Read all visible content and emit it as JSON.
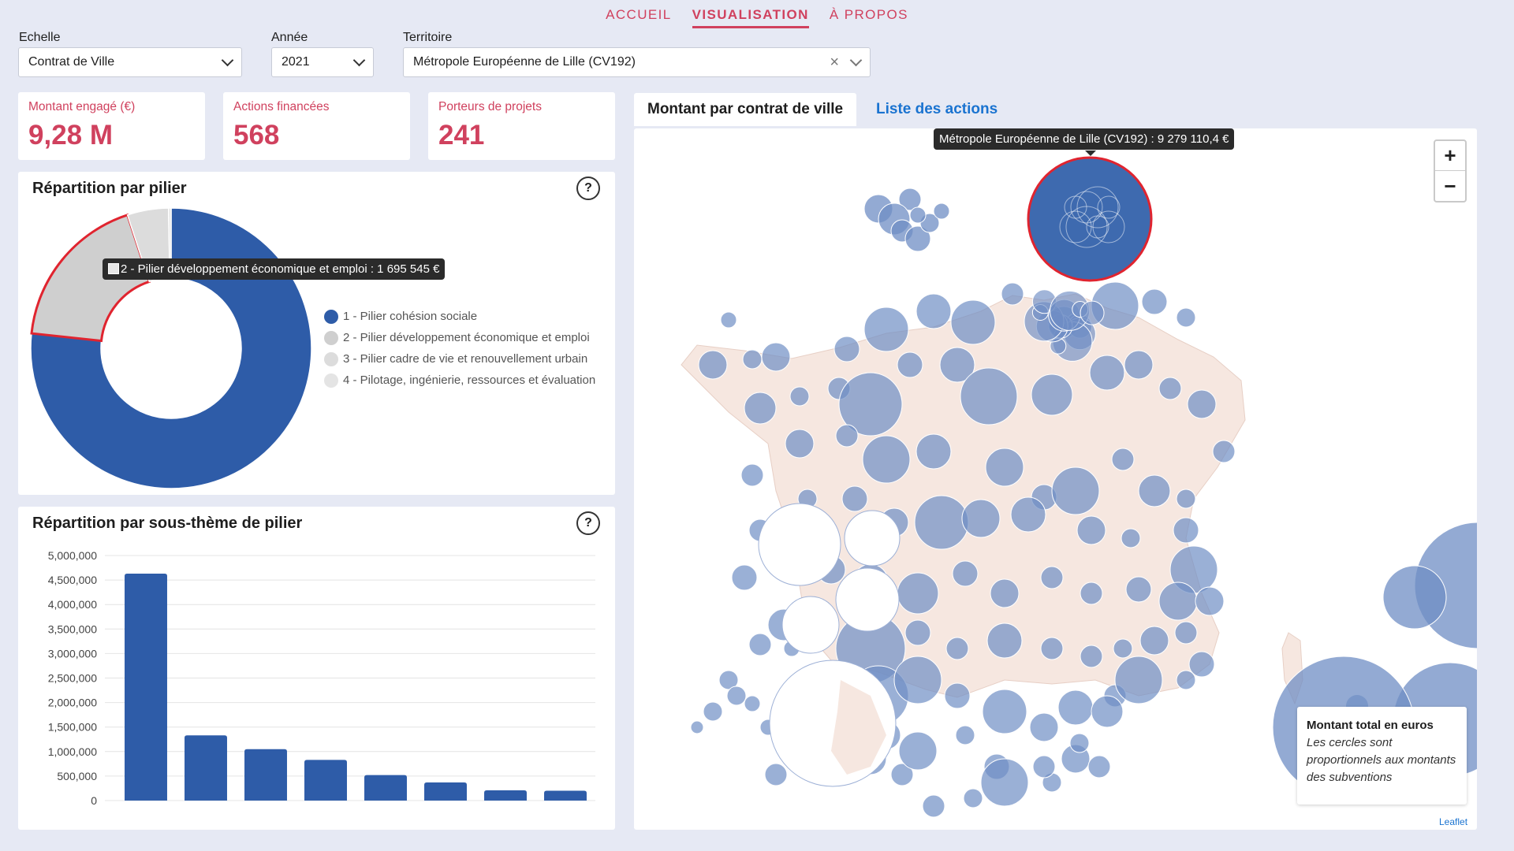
{
  "nav": {
    "items": [
      "ACCUEIL",
      "VISUALISATION",
      "À PROPOS"
    ],
    "active_index": 1
  },
  "filters": {
    "echelle": {
      "label": "Echelle",
      "value": "Contrat de Ville"
    },
    "annee": {
      "label": "Année",
      "value": "2021"
    },
    "territoire": {
      "label": "Territoire",
      "value": "Métropole Européenne de Lille (CV192)"
    }
  },
  "kpis": [
    {
      "label": "Montant engagé (€)",
      "value": "9,28 M"
    },
    {
      "label": "Actions financées",
      "value": "568"
    },
    {
      "label": "Porteurs de projets",
      "value": "241"
    }
  ],
  "donut": {
    "title": "Répartition par pilier",
    "help": "?",
    "tooltip": "2 - Pilier développement économique et emploi : 1 695 545 €",
    "colors": [
      "#2e5ca8",
      "#cfcfcf",
      "#dcdcdc",
      "#e4e4e4"
    ]
  },
  "bars": {
    "title": "Répartition par sous-thème de pilier",
    "help": "?",
    "color": "#2e5ca8"
  },
  "map": {
    "tabs": [
      "Montant par contrat de ville",
      "Liste des actions"
    ],
    "tooltip": "Métropole Européenne de Lille (CV192) : 9 279 110,4 €",
    "zoom_in": "+",
    "zoom_out": "−",
    "legend_title": "Montant total en euros",
    "legend_text": "Les cercles sont proportionnels aux montants des subventions",
    "attribution": "Leaflet",
    "bubble_color": "#6f8ec4",
    "highlight_color": "#e0242f"
  },
  "chart_data": [
    {
      "type": "pie",
      "title": "Répartition par pilier",
      "categories": [
        "1 - Pilier cohésion sociale",
        "2 - Pilier développement économique et emploi",
        "3 - Pilier cadre de vie et renouvellement urbain",
        "4 - Pilotage, ingénierie, ressources et évaluation"
      ],
      "values": [
        7117000,
        1695545,
        440000,
        27000
      ],
      "hole": 0.5,
      "legend": "right"
    },
    {
      "type": "bar",
      "title": "Répartition par sous-thème de pilier",
      "categories": [
        "",
        "",
        "",
        "",
        "",
        "",
        "",
        ""
      ],
      "values": [
        4630000,
        1330000,
        1050000,
        830000,
        520000,
        370000,
        210000,
        200000
      ],
      "ylim": [
        0,
        5000000
      ],
      "yticks": [
        0,
        500000,
        1000000,
        1500000,
        2000000,
        2500000,
        3000000,
        3500000,
        4000000,
        4500000,
        5000000
      ],
      "ytick_labels": [
        "0",
        "500,000",
        "1,000,000",
        "1,500,000",
        "2,000,000",
        "2,500,000",
        "3,000,000",
        "3,500,000",
        "4,000,000",
        "4,500,000",
        "5,000,000"
      ],
      "grid": true
    }
  ]
}
